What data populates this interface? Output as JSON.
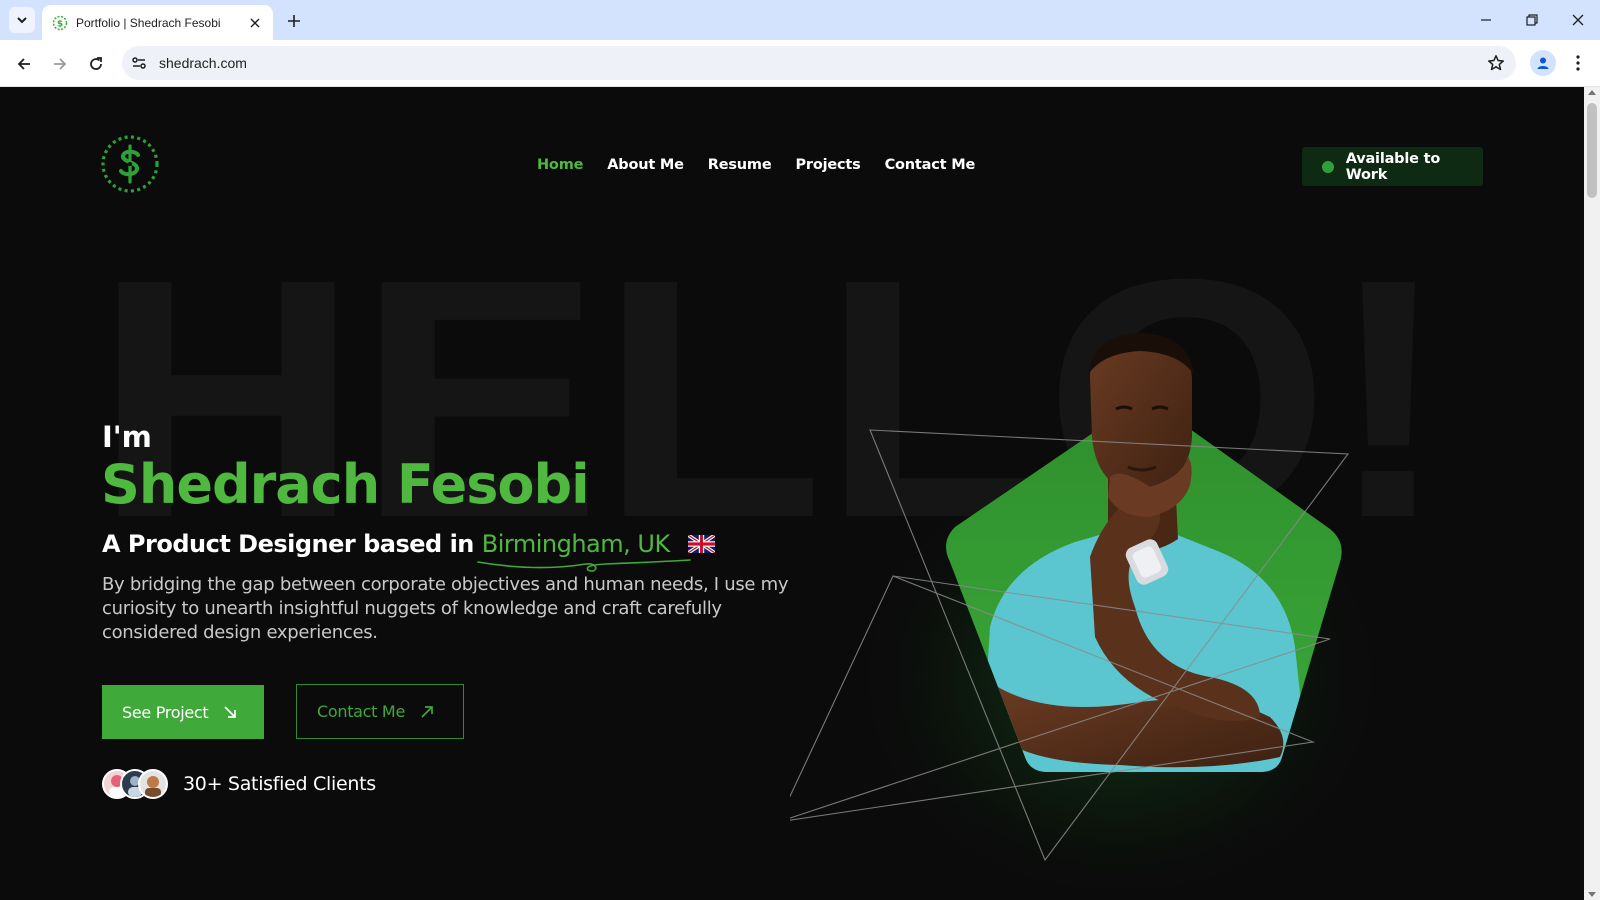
{
  "browser": {
    "tab_title": "Portfolio | Shedrach Fesobi",
    "url": "shedrach.com"
  },
  "site": {
    "nav": [
      {
        "label": "Home",
        "active": true
      },
      {
        "label": "About Me",
        "active": false
      },
      {
        "label": "Resume",
        "active": false
      },
      {
        "label": "Projects",
        "active": false
      },
      {
        "label": "Contact Me",
        "active": false
      }
    ],
    "availability": "Available to Work",
    "logo_icon": "dollar-sign-logo-icon"
  },
  "hero": {
    "background_word": "HELLO!",
    "intro": "I'm",
    "name": "Shedrach Fesobi",
    "role_prefix": "A Product Designer based in",
    "location": "Birmingham, UK",
    "flag_icon": "uk-flag-icon",
    "description": "By bridging the gap between corporate objectives and human needs, I use my curiosity to unearth insightful nuggets of knowledge and craft carefully considered design experiences.",
    "primary_cta": "See Project",
    "secondary_cta": "Contact Me",
    "clients_text": "30+ Satisfied Clients"
  },
  "colors": {
    "accent": "#4fb83f",
    "button_green": "#3fa93a",
    "background": "#0b0b0b",
    "badge_bg": "#0e2a12",
    "photo_backdrop": "#2f8f2c",
    "shirt": "#5bc6cf"
  }
}
